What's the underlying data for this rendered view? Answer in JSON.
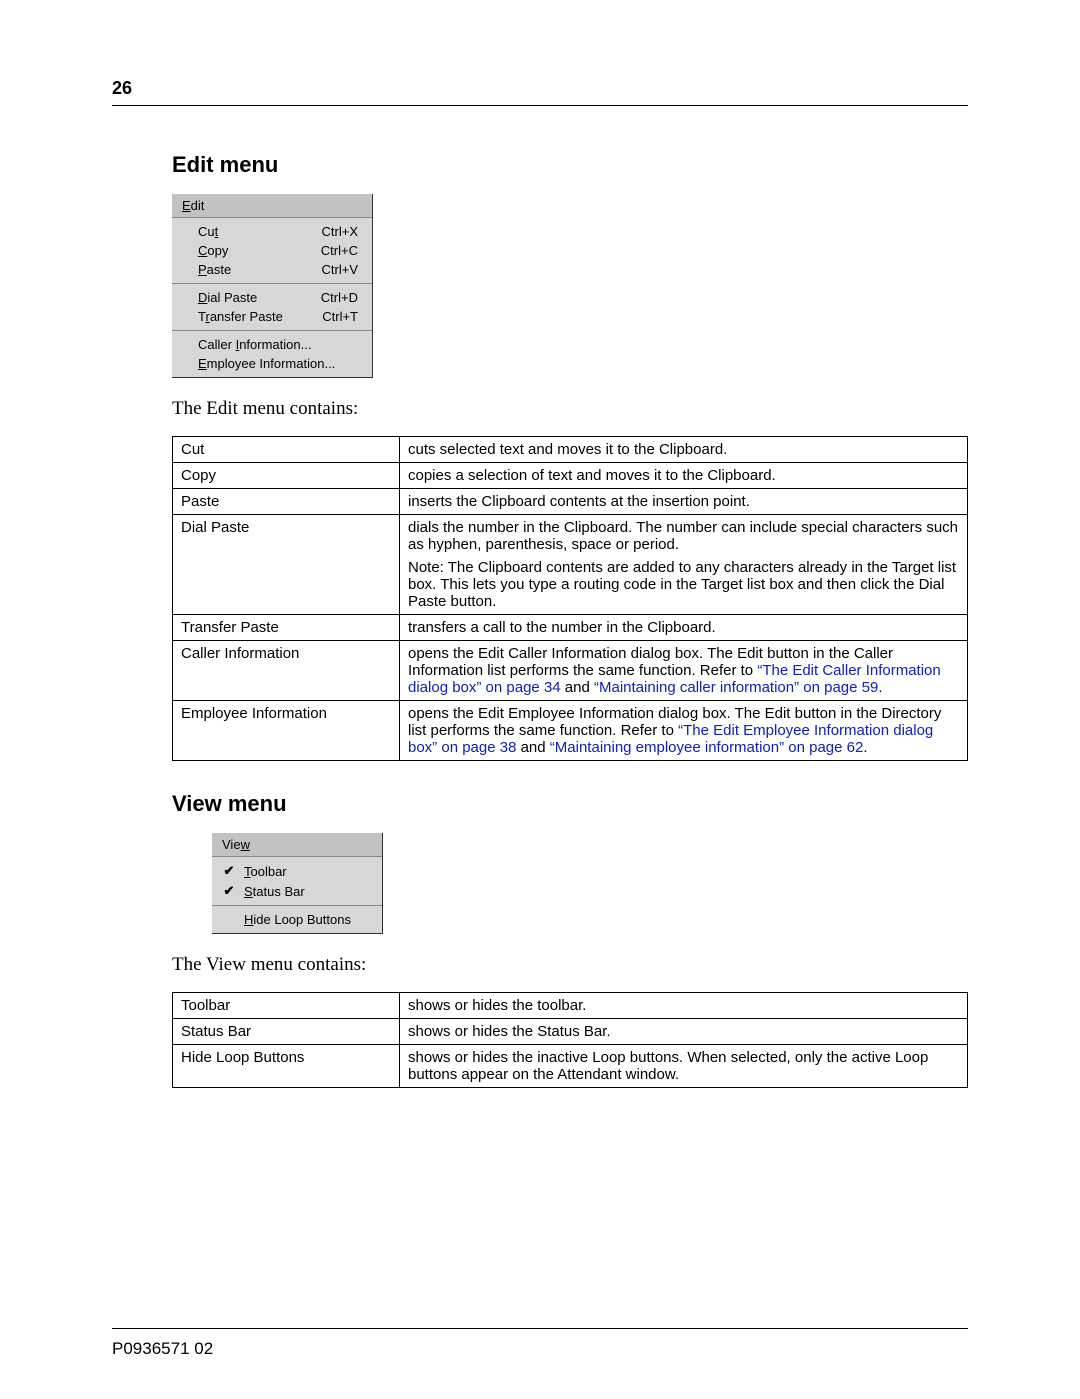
{
  "page_number": "26",
  "doc_id": "P0936571 02",
  "sections": {
    "edit": {
      "heading": "Edit menu",
      "intro": "The Edit menu contains:"
    },
    "view": {
      "heading": "View menu",
      "intro": "The View menu contains:"
    }
  },
  "edit_menu": {
    "title_pre": "E",
    "title_rest": "dit",
    "groups": [
      [
        {
          "pre": "Cu",
          "u": "t",
          "post": "",
          "short": "Ctrl+X"
        },
        {
          "pre": "",
          "u": "C",
          "post": "opy",
          "short": "Ctrl+C"
        },
        {
          "pre": "",
          "u": "P",
          "post": "aste",
          "short": "Ctrl+V"
        }
      ],
      [
        {
          "pre": "",
          "u": "D",
          "post": "ial Paste",
          "short": "Ctrl+D"
        },
        {
          "pre": "T",
          "u": "r",
          "post": "ansfer Paste",
          "short": "Ctrl+T"
        }
      ],
      [
        {
          "pre": "Caller ",
          "u": "I",
          "post": "nformation...",
          "short": ""
        },
        {
          "pre": "",
          "u": "E",
          "post": "mployee Information...",
          "short": ""
        }
      ]
    ]
  },
  "view_menu": {
    "title_pre": "Vie",
    "title_u": "w",
    "groups": [
      [
        {
          "check": "✔",
          "pre": "",
          "u": "T",
          "post": "oolbar"
        },
        {
          "check": "✔",
          "pre": "",
          "u": "S",
          "post": "tatus Bar"
        }
      ],
      [
        {
          "check": "",
          "pre": "",
          "u": "H",
          "post": "ide Loop Buttons"
        }
      ]
    ]
  },
  "edit_table": [
    {
      "k": "Cut",
      "v": [
        {
          "t": "cuts selected text and moves it to the Clipboard."
        }
      ]
    },
    {
      "k": "Copy",
      "v": [
        {
          "t": "copies a selection of text and moves it to the Clipboard."
        }
      ]
    },
    {
      "k": "Paste",
      "v": [
        {
          "t": "inserts the Clipboard contents at the insertion point."
        }
      ]
    },
    {
      "k": "Dial Paste",
      "v": [
        {
          "t": "dials the number in the Clipboard. The number can include special characters such as hyphen, parenthesis, space or period."
        },
        {
          "t": "Note: The Clipboard contents are added to any characters already in the Target list box. This lets you type a routing code in the Target list box and then click the Dial Paste button."
        }
      ]
    },
    {
      "k": "Transfer Paste",
      "v": [
        {
          "t": "transfers a call to the number in the Clipboard."
        }
      ]
    },
    {
      "k": "Caller Information",
      "v": [
        {
          "runs": [
            {
              "t": "opens the Edit Caller Information dialog box. The Edit button in the Caller Information list performs the same function. Refer to "
            },
            {
              "t": "“The Edit Caller Information dialog box” on page 34",
              "link": true
            },
            {
              "t": " and "
            },
            {
              "t": "“Maintaining caller information” on page 59",
              "link": true
            },
            {
              "t": "."
            }
          ]
        }
      ]
    },
    {
      "k": "Employee Information",
      "v": [
        {
          "runs": [
            {
              "t": "opens the Edit Employee Information dialog box. The Edit button in the Directory list performs the same function. Refer to "
            },
            {
              "t": "“The Edit Employee Information dialog box” on page 38",
              "link": true
            },
            {
              "t": " and "
            },
            {
              "t": "“Maintaining employee information” on page 62",
              "link": true
            },
            {
              "t": "."
            }
          ]
        }
      ]
    }
  ],
  "view_table": [
    {
      "k": "Toolbar",
      "v": "shows or hides the toolbar."
    },
    {
      "k": "Status Bar",
      "v": "shows or hides the Status Bar."
    },
    {
      "k": "Hide Loop Buttons",
      "v": "shows or hides the inactive Loop buttons. When selected, only the active Loop buttons appear on the Attendant window."
    }
  ]
}
